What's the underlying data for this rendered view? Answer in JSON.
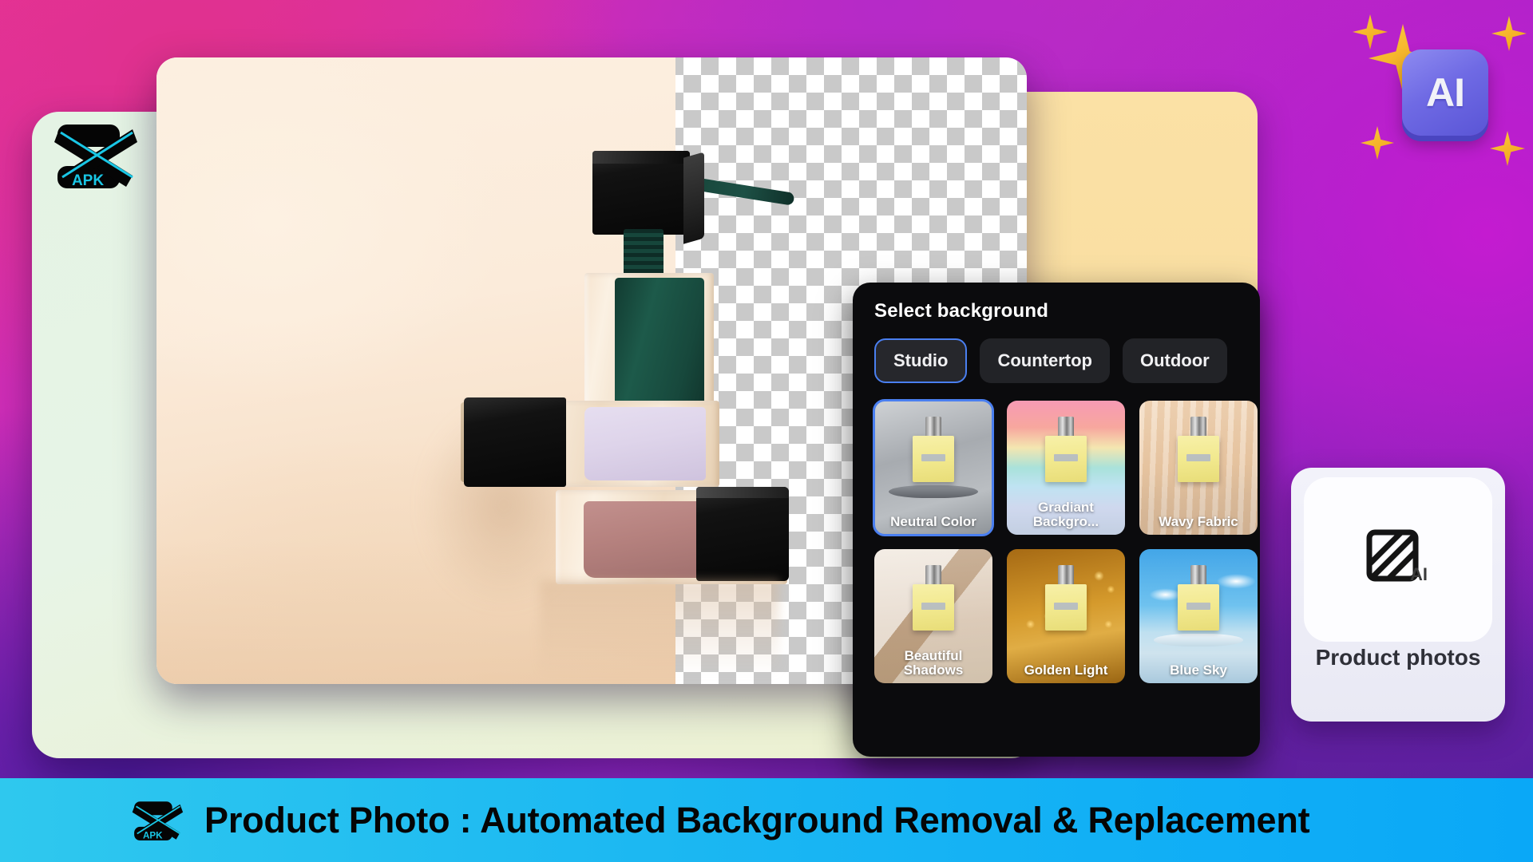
{
  "brand": {
    "logo_name": "capcut-apk-logo",
    "logo_text": "APK"
  },
  "ai_badge": {
    "label": "AI",
    "sparkle_color": "#f7b32b",
    "square_color": "#6f6ae4"
  },
  "editor": {
    "canvas_name": "product-photo-canvas",
    "transparency_checker": "transparent-background-checkerboard"
  },
  "panel": {
    "title": "Select background",
    "tabs": [
      {
        "label": "Studio",
        "selected": true
      },
      {
        "label": "Countertop",
        "selected": false
      },
      {
        "label": "Outdoor",
        "selected": false
      }
    ],
    "selected_tab": "Studio",
    "accent_color": "#4a7ff0",
    "thumbnails": [
      {
        "label": "Neutral Color",
        "style": "bg-neutral",
        "selected": true
      },
      {
        "label": "Gradiant Backgro...",
        "style": "bg-gradiant",
        "selected": false
      },
      {
        "label": "Wavy Fabric",
        "style": "bg-wavy",
        "selected": false
      },
      {
        "label": "Beautiful Shadows",
        "style": "bg-shadows",
        "selected": false
      },
      {
        "label": "Golden Light",
        "style": "bg-golden",
        "selected": false
      },
      {
        "label": "Blue Sky",
        "style": "bg-bluesky",
        "selected": false
      }
    ]
  },
  "product_card": {
    "label": "Product photos",
    "icon": "ai-image-icon",
    "icon_badge": "AI"
  },
  "banner": {
    "text": "Product Photo : Automated Background Removal & Replacement",
    "background_color": "#1cb8f2",
    "text_color": "#050505"
  }
}
